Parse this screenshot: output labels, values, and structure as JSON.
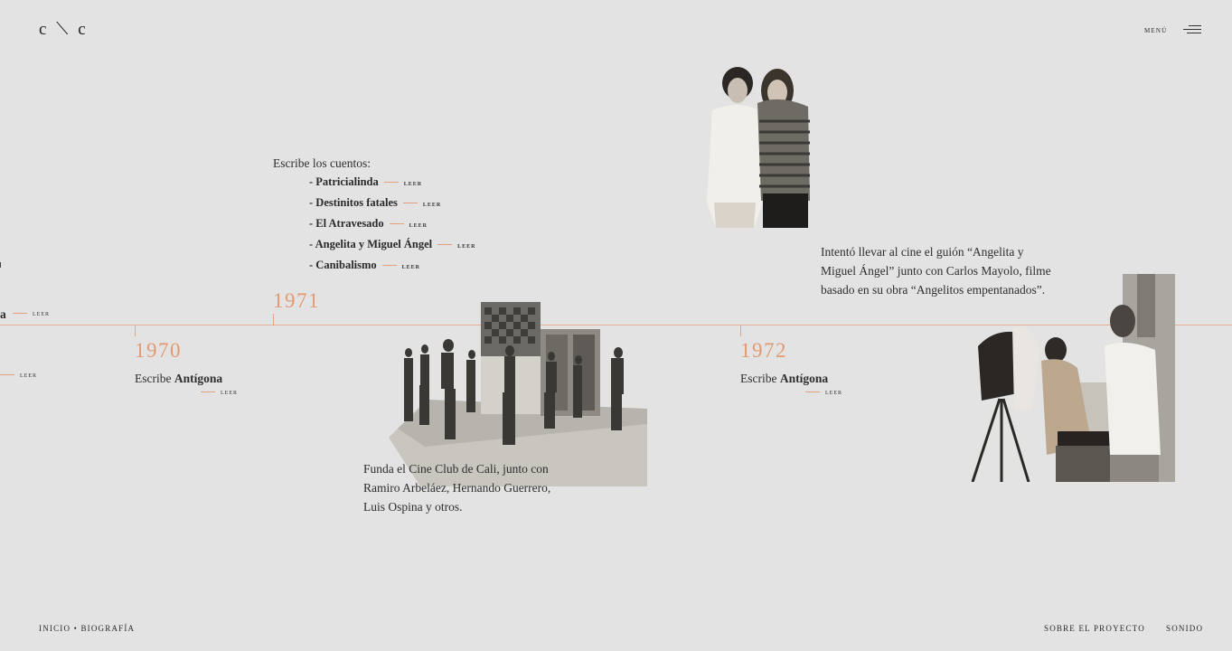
{
  "header": {
    "logo": "c ⟍ c",
    "menu_label": "MENÚ"
  },
  "left_cut": {
    "tail_text": "a",
    "leer1": "LEER",
    "leer2": "LEER"
  },
  "timeline": {
    "events": [
      {
        "year": "1970",
        "prefix": "Escribe",
        "title": "Antígona",
        "leer": "LEER"
      },
      {
        "year": "1971",
        "intro": "Escribe los cuentos:",
        "stories": [
          {
            "title": "- Patricialinda",
            "leer": "LEER"
          },
          {
            "title": "- Destinitos fatales",
            "leer": "LEER"
          },
          {
            "title": "- El Atravesado",
            "leer": "LEER"
          },
          {
            "title": "- Angelita y Miguel Ángel",
            "leer": "LEER"
          },
          {
            "title": "- Canibalismo",
            "leer": "LEER"
          }
        ],
        "caption_lines": [
          "Funda el Cine Club de Cali, junto con",
          "Ramiro Arbeláez, Hernando Guerrero,",
          "Luis Ospina y otros."
        ]
      },
      {
        "year": "1972",
        "prefix": "Escribe",
        "title": "Antígona",
        "leer": "LEER",
        "note_lines": [
          "Intentó llevar al cine el guión “Angelita y",
          "Miguel Ángel” junto con Carlos Mayolo, filme",
          "basado en su obra “Angelitos empentanados”."
        ]
      }
    ]
  },
  "footer": {
    "breadcrumb": "INICIO • BIOGRAFÍA",
    "about": "SOBRE EL PROYECTO",
    "sound": "SONIDO"
  },
  "colors": {
    "accent": "#e29a72",
    "background": "#e3e3e3",
    "text": "#2a2a2a"
  },
  "icons": {
    "menu": "hamburger-menu-icon"
  }
}
